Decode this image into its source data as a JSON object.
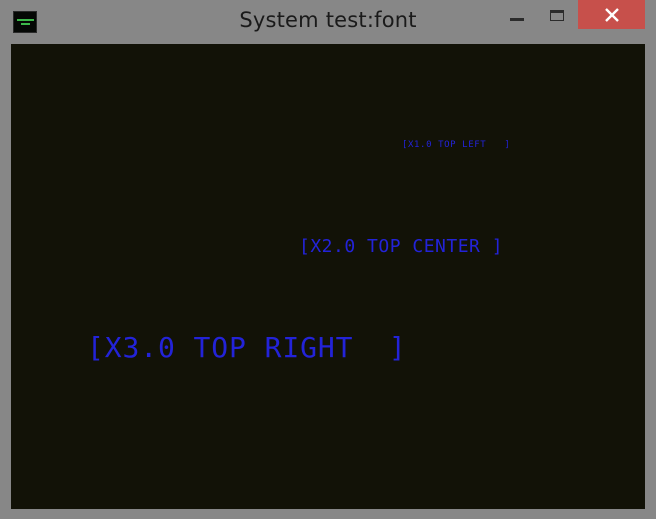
{
  "window": {
    "title": "System test:font"
  },
  "icons": {
    "app": "app-icon",
    "minimize": "minimize-icon",
    "maximize": "maximize-icon",
    "close": "close-icon"
  },
  "colors": {
    "canvas_bg": "#121207",
    "text": "#2323d8",
    "close_button": "#c7504b",
    "frame": "#878787"
  },
  "canvas": {
    "lines": [
      {
        "text": "[X1.0 TOP LEFT   ]"
      },
      {
        "text": "[X2.0 TOP CENTER ]"
      },
      {
        "text": "[X3.0 TOP RIGHT  ]"
      }
    ]
  }
}
